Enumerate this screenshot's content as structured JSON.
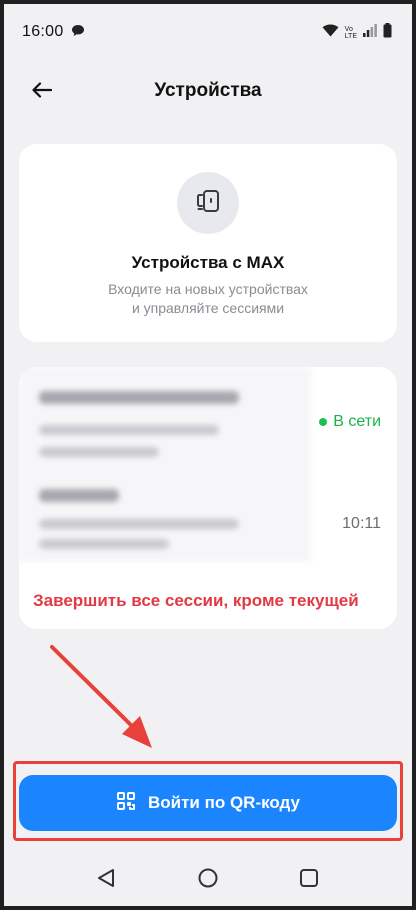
{
  "status_bar": {
    "time": "16:00",
    "icons": [
      "chat-bubble-icon",
      "wifi-icon",
      "volte-icon",
      "signal-icon",
      "battery-icon"
    ],
    "volte_top": "Vo",
    "volte_bottom": "LTE"
  },
  "header": {
    "title": "Устройства",
    "back_icon": "arrow-left-icon"
  },
  "devices_card": {
    "icon": "devices-icon",
    "title": "Устройства с MAX",
    "subtitle_line1": "Входите на новых устройствах",
    "subtitle_line2": "и управляйте сессиями"
  },
  "sessions": {
    "current_status": "В сети",
    "other_time": "10:11",
    "terminate_label": "Завершить все сессии, кроме текущей"
  },
  "qr_button": {
    "label": "Войти по QR-коду",
    "icon": "qr-code-icon"
  },
  "colors": {
    "accent": "#1a85ff",
    "danger": "#e23a44",
    "online": "#19b24b",
    "annotation": "#e8403a"
  },
  "nav": {
    "back_icon": "nav-back-icon",
    "home_icon": "nav-home-icon",
    "recents_icon": "nav-recents-icon"
  }
}
